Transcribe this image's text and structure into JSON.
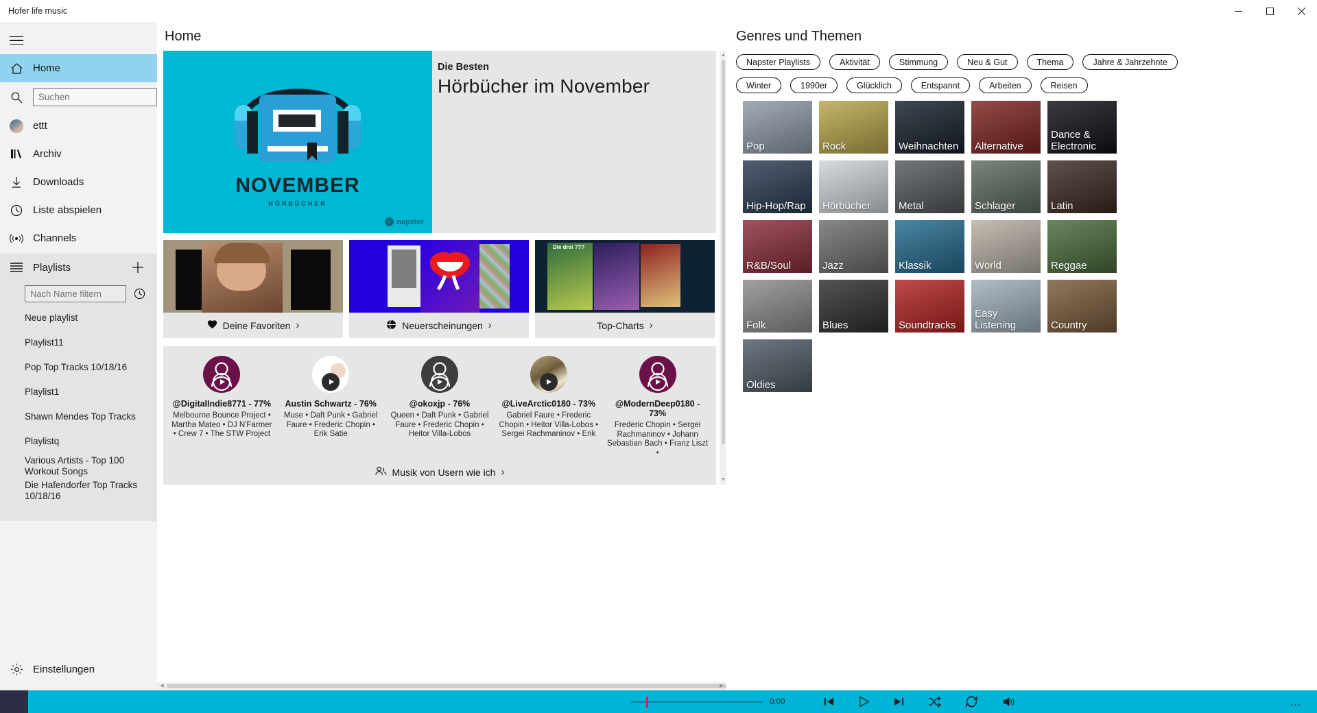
{
  "window": {
    "title": "Hofer life music",
    "minimize_icon": "minimize-icon",
    "maximize_icon": "maximize-icon",
    "close_icon": "close-icon"
  },
  "sidebar": {
    "menu_icon": "hamburger-icon",
    "nav": [
      {
        "label": "Home",
        "icon": "home-icon",
        "active": true
      },
      {
        "label": "ettt",
        "icon": "avatar-icon",
        "active": false
      },
      {
        "label": "Archiv",
        "icon": "library-icon",
        "active": false
      },
      {
        "label": "Downloads",
        "icon": "download-icon",
        "active": false
      },
      {
        "label": "Liste abspielen",
        "icon": "clock-icon",
        "active": false
      },
      {
        "label": "Channels",
        "icon": "broadcast-icon",
        "active": false
      }
    ],
    "search": {
      "placeholder": "Suchen",
      "value": "",
      "icon": "search-icon"
    },
    "playlists": {
      "title": "Playlists",
      "list_icon": "list-icon",
      "add_icon": "plus-icon",
      "history_icon": "clock-icon",
      "filter_placeholder": "Nach Name filtern",
      "filter_value": "",
      "items": [
        "Neue playlist",
        "Playlist11",
        "Pop Top Tracks 10/18/16",
        "Playlist1",
        "Shawn Mendes Top Tracks",
        "Playlistq",
        "Various Artists - Top 100 Workout Songs",
        "Die Hafendorfer Top Tracks 10/18/16"
      ]
    },
    "settings": {
      "label": "Einstellungen",
      "icon": "gear-icon"
    }
  },
  "main": {
    "title": "Home",
    "hero": {
      "kicker": "Die Besten",
      "headline": "Hörbücher im November",
      "art_word": "NOVEMBER",
      "art_sub": "HÖRBÜCHER",
      "brand": "napster",
      "art_color": "#00b7d4"
    },
    "cards": [
      {
        "label": "Deine Favoriten",
        "icon": "heart-icon",
        "chevron": "›",
        "art_color": "#a2957c"
      },
      {
        "label": "Neuerscheinungen",
        "icon": "globe-icon",
        "chevron": "›",
        "art_color": "#2200dd"
      },
      {
        "label": "Top-Charts",
        "icon": "",
        "chevron": "›",
        "art_color": "#0e2233"
      }
    ],
    "users": [
      {
        "name": "@DigitalIndie8771 - 77%",
        "artists": "Melbourne Bounce Project • Martha Mateo • DJ N'Farmer • Crew 7 • The STW Project",
        "avatar_color": "#6b1048",
        "avatar_type": "glyph"
      },
      {
        "name": "Austin Schwartz - 76%",
        "artists": "Muse • Daft Punk • Gabriel Faure • Frederic Chopin • Erik Satie",
        "avatar_color": "#ffffff",
        "avatar_type": "photo-anime"
      },
      {
        "name": "@okoxjp - 76%",
        "artists": "Queen • Daft Punk • Gabriel Faure • Frederic Chopin • Heitor Villa-Lobos",
        "avatar_color": "#3d3d3d",
        "avatar_type": "glyph"
      },
      {
        "name": "@LiveArctic0180 - 73%",
        "artists": "Gabriel Faure • Frederic Chopin • Heitor Villa-Lobos • Sergei Rachmaninov • Erik",
        "avatar_color": "#8a7a58",
        "avatar_type": "photo"
      },
      {
        "name": "@ModernDeep0180 - 73%",
        "artists": "Frederic Chopin • Sergei Rachmaninov • Johann Sebastian Bach • Franz Liszt •",
        "avatar_color": "#6b1048",
        "avatar_type": "glyph"
      }
    ],
    "users_more": {
      "label": "Musik von Usern wie ich",
      "icon": "people-icon",
      "chevron": "›"
    }
  },
  "genres": {
    "title": "Genres und Themen",
    "chips_row1": [
      "Napster Playlists",
      "Aktivität",
      "Stimmung",
      "Neu & Gut",
      "Thema",
      "Jahre & Jahrzehnte"
    ],
    "chips_row2": [
      "Winter",
      "1990er",
      "Glücklich",
      "Entspannt",
      "Arbeiten",
      "Reisen"
    ],
    "tiles": [
      {
        "label": "Pop",
        "color": "#8e9aa8"
      },
      {
        "label": "Rock",
        "color": "#b8a64a"
      },
      {
        "label": "Weihnachten",
        "color": "#18202c"
      },
      {
        "label": "Alternative",
        "color": "#7e2420"
      },
      {
        "label": "Dance & Electronic",
        "color": "#101018"
      },
      {
        "label": "Hip-Hop/Rap",
        "color": "#2a3c52"
      },
      {
        "label": "Hörbücher",
        "color": "#cfd4d8"
      },
      {
        "label": "Metal",
        "color": "#54585c"
      },
      {
        "label": "Schlager",
        "color": "#5d6b60"
      },
      {
        "label": "Latin",
        "color": "#3d2a22"
      },
      {
        "label": "R&B/Soul",
        "color": "#8b2d3a"
      },
      {
        "label": "Jazz",
        "color": "#6e6e6e"
      },
      {
        "label": "Klassik",
        "color": "#246b8e"
      },
      {
        "label": "World",
        "color": "#b8b0a4"
      },
      {
        "label": "Reggae",
        "color": "#4a6b3a"
      },
      {
        "label": "Folk",
        "color": "#8c8c8c"
      },
      {
        "label": "Blues",
        "color": "#2e2e2e"
      },
      {
        "label": "Soundtracks",
        "color": "#b22222"
      },
      {
        "label": "Easy Listening",
        "color": "#9fb0bd"
      },
      {
        "label": "Country",
        "color": "#7a5a3a"
      },
      {
        "label": "Oldies",
        "color": "#4f5a66"
      }
    ]
  },
  "player": {
    "time": "0:00",
    "progress_percent": 11,
    "controls": [
      {
        "name": "previous-button",
        "icon": "skip-previous-icon"
      },
      {
        "name": "play-button",
        "icon": "play-icon"
      },
      {
        "name": "next-button",
        "icon": "skip-next-icon"
      },
      {
        "name": "shuffle-button",
        "icon": "shuffle-icon"
      },
      {
        "name": "repeat-button",
        "icon": "repeat-icon"
      },
      {
        "name": "volume-button",
        "icon": "volume-icon"
      }
    ],
    "overflow": "…",
    "accent": "#00b4d8"
  }
}
